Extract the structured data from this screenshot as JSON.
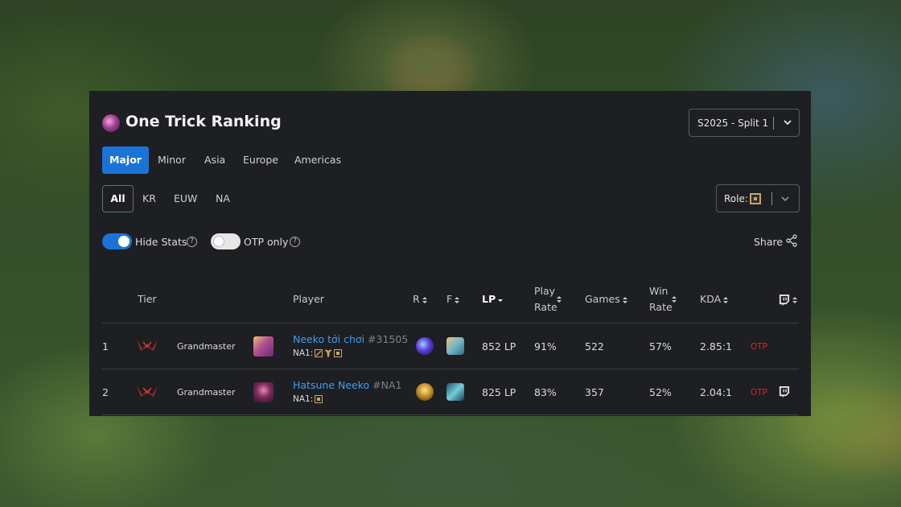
{
  "header": {
    "title": "One Trick Ranking",
    "season": "S2025 - Split 1"
  },
  "tabs": [
    {
      "label": "Major",
      "active": true
    },
    {
      "label": "Minor",
      "active": false
    },
    {
      "label": "Asia",
      "active": false
    },
    {
      "label": "Europe",
      "active": false
    },
    {
      "label": "Americas",
      "active": false
    }
  ],
  "regions": [
    {
      "label": "All",
      "active": true
    },
    {
      "label": "KR",
      "active": false
    },
    {
      "label": "EUW",
      "active": false
    },
    {
      "label": "NA",
      "active": false
    }
  ],
  "role_filter": {
    "label": "Role:",
    "icon": "mid-lane-role-icon"
  },
  "toggles": {
    "hide_stats": {
      "label": "Hide Stats",
      "on": true
    },
    "otp_only": {
      "label": "OTP only",
      "on": false
    }
  },
  "share_label": "Share",
  "table": {
    "headers": {
      "tier": "Tier",
      "player": "Player",
      "r": "R",
      "f": "F",
      "lp": "LP",
      "play_rate_1": "Play",
      "play_rate_2": "Rate",
      "games": "Games",
      "win_rate_1": "Win",
      "win_rate_2": "Rate",
      "kda": "KDA",
      "stream": "twitch-icon"
    },
    "rows": [
      {
        "rank": "1",
        "tier": "Grandmaster",
        "name": "Neeko tới chơi",
        "tag": "#31505",
        "server": "NA1:",
        "lp": "852 LP",
        "play_rate": "91%",
        "games": "522",
        "win_rate": "57%",
        "kda": "2.85:1",
        "otp": "OTP",
        "twitch": false
      },
      {
        "rank": "2",
        "tier": "Grandmaster",
        "name": "Hatsune Neeko",
        "tag": "#NA1",
        "server": "NA1:",
        "lp": "825 LP",
        "play_rate": "83%",
        "games": "357",
        "win_rate": "52%",
        "kda": "2.04:1",
        "otp": "OTP",
        "twitch": true
      }
    ]
  },
  "colors": {
    "accent": "#1a73d6",
    "link": "#3d9df0",
    "otp": "#e02020",
    "panel": "#1e1f22"
  }
}
